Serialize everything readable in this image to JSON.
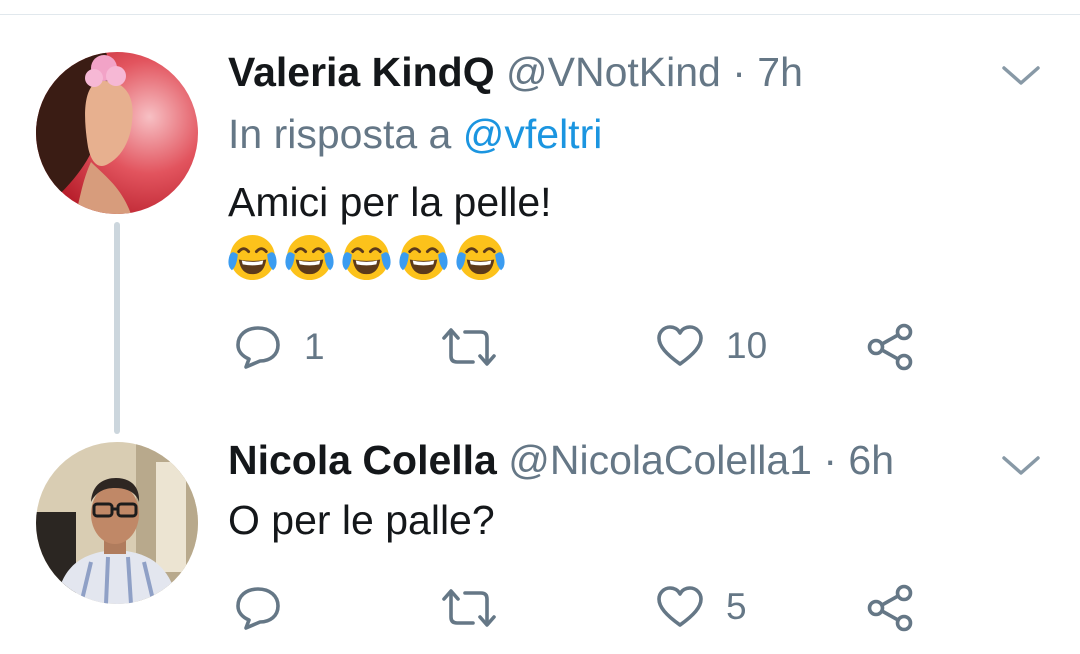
{
  "tweets": [
    {
      "name": "Valeria KindQ",
      "handle": "@VNotKind",
      "time": "· 7h",
      "reply_prefix": "In risposta a",
      "reply_mention": "@vfeltri",
      "text": "Amici per la pelle!",
      "emojis": [
        "face-with-tears-of-joy",
        "face-with-tears-of-joy",
        "face-with-tears-of-joy",
        "face-with-tears-of-joy",
        "face-with-tears-of-joy"
      ],
      "replies": "1",
      "retweets": "",
      "likes": "10"
    },
    {
      "name": "Nicola Colella",
      "handle": "@NicolaColella1",
      "time": "· 6h",
      "text": "O per le palle?",
      "replies": "",
      "retweets": "",
      "likes": "5"
    }
  ],
  "icons": {
    "reply": "reply-icon",
    "retweet": "retweet-icon",
    "like": "heart-icon",
    "share": "share-icon",
    "more": "chevron-down-icon"
  },
  "colors": {
    "name": "#14171a",
    "meta": "#657786",
    "link": "#1b95e0",
    "thread_line": "#ccd6dd"
  }
}
